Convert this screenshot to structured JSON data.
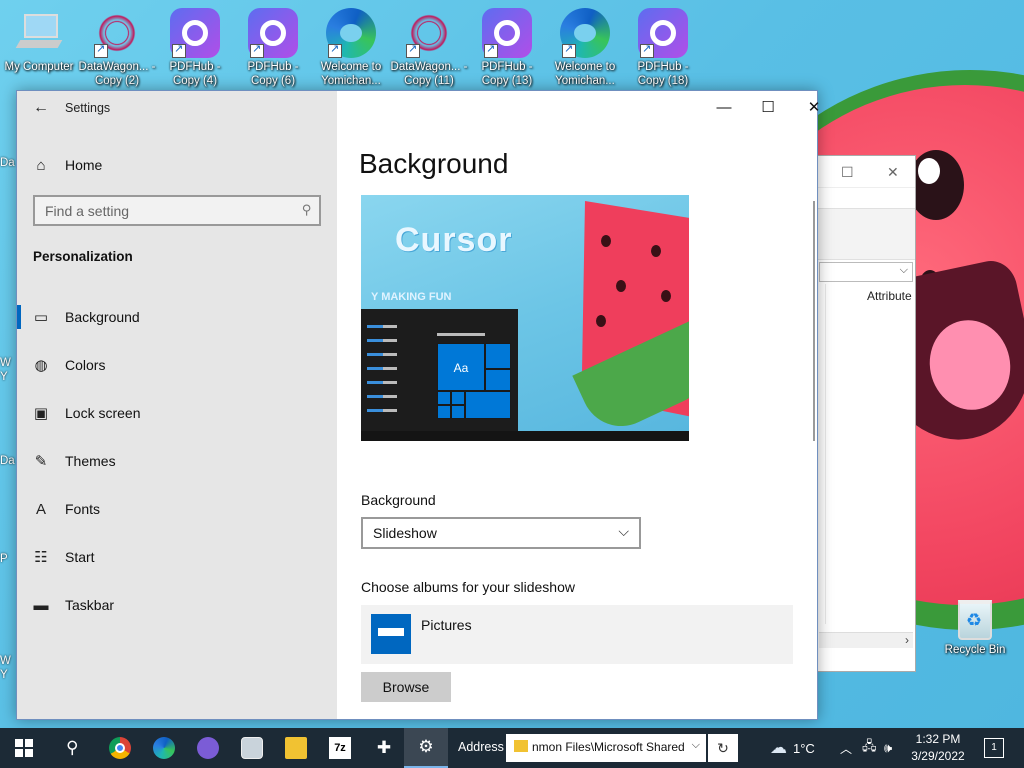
{
  "desktop": {
    "icons": [
      {
        "label": "My Computer",
        "type": "mycomp"
      },
      {
        "label": "DataWagon... - Copy (2)",
        "type": "datawagon"
      },
      {
        "label": "PDFHub - Copy (4)",
        "type": "pdfhub"
      },
      {
        "label": "PDFHub - Copy (6)",
        "type": "pdfhub"
      },
      {
        "label": "Welcome to Yomichan...",
        "type": "edge"
      },
      {
        "label": "DataWagon... - Copy (11)",
        "type": "datawagon"
      },
      {
        "label": "PDFHub - Copy (13)",
        "type": "pdfhub"
      },
      {
        "label": "Welcome to Yomichan...",
        "type": "edge"
      },
      {
        "label": "PDFHub - Copy (18)",
        "type": "pdfhub"
      }
    ],
    "edge_labels": [
      "Da",
      "W",
      "Y",
      "Da",
      "P",
      "W",
      "Y"
    ],
    "recycle_bin": "Recycle Bin"
  },
  "explorer": {
    "column_header": "Attribute",
    "address_chevron": "⌵",
    "scroll_arrow": "›"
  },
  "settings": {
    "app_title": "Settings",
    "back_icon": "←",
    "home": "Home",
    "search_placeholder": "Find a setting",
    "section": "Personalization",
    "nav": [
      {
        "label": "Background",
        "icon": "picture-icon",
        "glyph": "▭",
        "active": true
      },
      {
        "label": "Colors",
        "icon": "palette-icon",
        "glyph": "◍",
        "active": false
      },
      {
        "label": "Lock screen",
        "icon": "lock-screen-icon",
        "glyph": "▣",
        "active": false
      },
      {
        "label": "Themes",
        "icon": "themes-icon",
        "glyph": "✎",
        "active": false
      },
      {
        "label": "Fonts",
        "icon": "fonts-icon",
        "glyph": "A",
        "active": false
      },
      {
        "label": "Start",
        "icon": "start-icon",
        "glyph": "☷",
        "active": false
      },
      {
        "label": "Taskbar",
        "icon": "taskbar-icon",
        "glyph": "▬",
        "active": false
      }
    ],
    "window_controls": {
      "minimize": "—",
      "maximize": "☐",
      "close": "✕"
    },
    "page_title": "Background",
    "preview": {
      "wallpaper_text": "Cursor",
      "wallpaper_small": "Y MAKING FUN",
      "tile_text": "Aa"
    },
    "background_label": "Background",
    "background_value": "Slideshow",
    "albums_label": "Choose albums for your slideshow",
    "album_name": "Pictures",
    "browse_label": "Browse"
  },
  "taskbar": {
    "address_label": "Address",
    "address_value": "nmon Files\\Microsoft Shared",
    "weather": "1°C",
    "time": "1:32 PM",
    "date": "3/29/2022",
    "notifications": "1"
  },
  "colors": {
    "accent": "#0067c0",
    "taskbar_bg": "#1c2a36",
    "nav_bg": "#e6e6e6"
  }
}
